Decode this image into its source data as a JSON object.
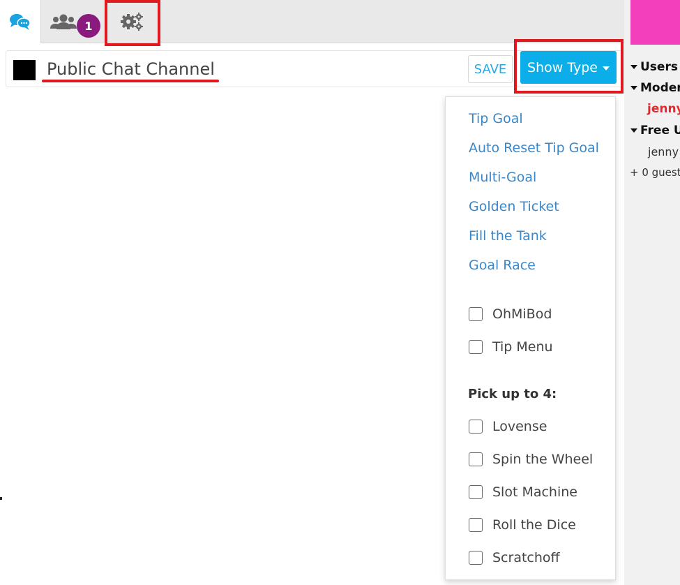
{
  "tabs": {
    "chat_icon": "chat-bubbles-icon",
    "users_icon": "users-group-icon",
    "users_badge": "1",
    "settings_icon": "gears-icon"
  },
  "channel": {
    "name": "Public Chat Channel",
    "color": "#000000",
    "save_label": "SAVE"
  },
  "show_type": {
    "label": "Show Type"
  },
  "dropdown": {
    "goal_links": [
      "Tip Goal",
      "Auto Reset Tip Goal",
      "Multi-Goal",
      "Golden Ticket",
      "Fill the Tank",
      "Goal Race"
    ],
    "toggles": [
      "OhMiBod",
      "Tip Menu"
    ],
    "pick_heading": "Pick up to 4:",
    "pick_options": [
      "Lovense",
      "Spin the Wheel",
      "Slot Machine",
      "Roll the Dice",
      "Scratchoff"
    ]
  },
  "sidebar": {
    "users_heading": "Users",
    "moderators_heading": "Moder",
    "moderator_user": "jenny",
    "free_heading": "Free U",
    "free_user": "jenny",
    "guests": "+ 0 guest"
  },
  "colors": {
    "accent": "#0baee8",
    "highlight": "#e1191f",
    "badge": "#8b1a7f",
    "pink": "#f43fbd",
    "link": "#3a87c9"
  }
}
